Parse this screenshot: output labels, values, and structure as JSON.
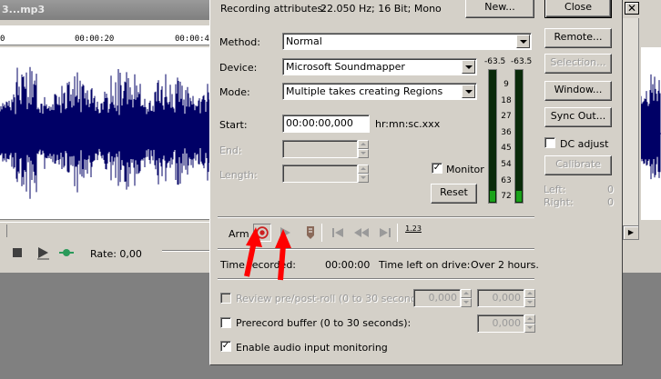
{
  "background_editor": {
    "title": "3...mp3",
    "ruler_ticks": [
      "0",
      "00:00:20",
      "00:00:40"
    ],
    "rate_label": "Rate: 0,00"
  },
  "dialog": {
    "recording_attributes_label": "Recording attributes:",
    "recording_attributes_value": "22.050 Hz; 16 Bit; Mono",
    "new_button": "New...",
    "close_button": "Close",
    "method_label": "Method:",
    "method_value": "Normal",
    "device_label": "Device:",
    "device_value": "Microsoft Soundmapper",
    "mode_label": "Mode:",
    "mode_value": "Multiple takes creating Regions",
    "start_label": "Start:",
    "start_value": "00:00:00,000",
    "time_format": "hr:mn:sc.xxx",
    "end_label": "End:",
    "length_label": "Length:",
    "monitor_label": "Monitor",
    "monitor_checked": true,
    "reset_button": "Reset",
    "meter_top_left": "-63.5",
    "meter_top_right": "-63.5",
    "meter_scale": [
      "9",
      "18",
      "27",
      "36",
      "45",
      "54",
      "63",
      "72"
    ],
    "meter_level_fraction": 0.08,
    "side_buttons": {
      "remote": "Remote...",
      "selection": "Selection...",
      "window": "Window...",
      "sync_out": "Sync Out...",
      "calibrate": "Calibrate"
    },
    "dc_adjust_label": "DC adjust",
    "dc_adjust_checked": false,
    "left_label": "Left:",
    "left_value": "0",
    "right_label": "Right:",
    "right_value": "0",
    "arm_label": "Arm",
    "counter_icon_text": "1.23",
    "time_recorded_label": "Time recorded:",
    "time_recorded_value": "00:00:00",
    "time_left_label": "Time left on drive:",
    "time_left_value": "Over 2 hours.",
    "review_label": "Review pre/post-roll (0 to 30 seconds):",
    "review_pre_value": "0,000",
    "review_post_value": "0,000",
    "prerecord_label": "Prerecord buffer (0 to 30 seconds):",
    "prerecord_value": "0,000",
    "enable_monitoring_label": "Enable audio input monitoring",
    "enable_monitoring_checked": true
  },
  "right_window": {
    "close_glyph": "✕"
  },
  "colors": {
    "dialog_bg": "#d4d0c8",
    "wave": "#000066",
    "meter_green": "#1aa21a",
    "record_red": "#cc2020",
    "annotation_red": "#ff0000"
  },
  "icons": {
    "record": "record-icon",
    "play": "play-icon",
    "marker": "marker-icon",
    "go_start": "go-to-start-icon",
    "rewind": "rewind-icon",
    "go_end": "go-to-end-icon",
    "counter": "counter-icon"
  }
}
